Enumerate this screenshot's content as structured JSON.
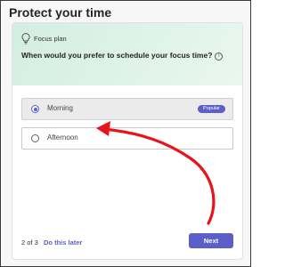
{
  "window": {
    "title": "Protect your time"
  },
  "card": {
    "plan_label": "Focus plan",
    "question": "When would you prefer to schedule your focus time?",
    "info_icon": "info-icon",
    "options": [
      {
        "label": "Morning",
        "selected": true,
        "badge": "Popular"
      },
      {
        "label": "Afternoon",
        "selected": false
      }
    ]
  },
  "footer": {
    "step": "2 of 3",
    "later_link": "Do this later",
    "next_label": "Next"
  },
  "colors": {
    "accent": "#5b5fc7",
    "header_bg": "#d9f0e4",
    "annotation_arrow": "#e8141b"
  }
}
